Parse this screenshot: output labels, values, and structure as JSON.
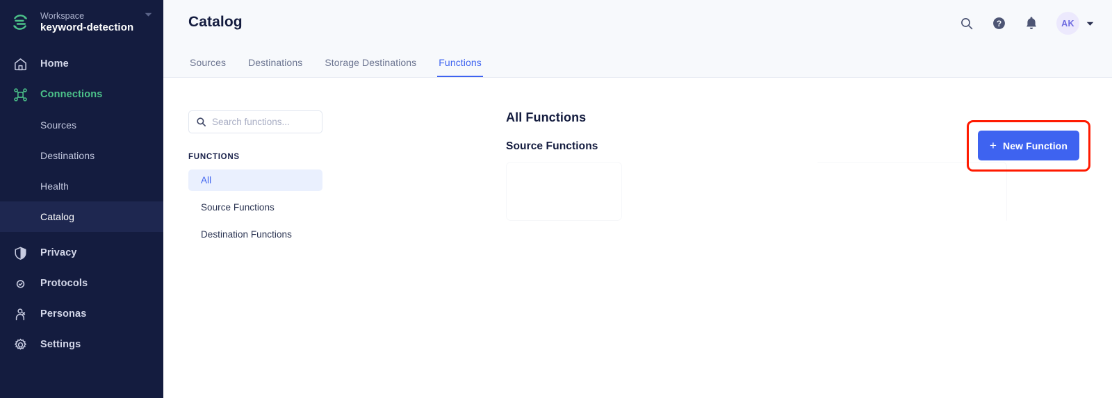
{
  "sidebar": {
    "workspace": {
      "label": "Workspace",
      "name": "keyword-detection",
      "caret_icon": "chevron-down-icon",
      "logo_icon": "segment-logo-icon"
    },
    "items": [
      {
        "label": "Home",
        "icon": "home-icon",
        "accent": false
      },
      {
        "label": "Connections",
        "icon": "connections-nodes-icon",
        "accent": true
      },
      {
        "label": "Privacy",
        "icon": "shield-icon",
        "accent": false
      },
      {
        "label": "Protocols",
        "icon": "protocols-icon",
        "accent": false
      },
      {
        "label": "Personas",
        "icon": "persona-icon",
        "accent": false
      },
      {
        "label": "Settings",
        "icon": "gear-icon",
        "accent": false
      }
    ],
    "sub_items": [
      {
        "label": "Sources",
        "active": false
      },
      {
        "label": "Destinations",
        "active": false
      },
      {
        "label": "Health",
        "active": false
      },
      {
        "label": "Catalog",
        "active": true
      }
    ]
  },
  "header": {
    "title": "Catalog",
    "icons": [
      {
        "name": "search-icon"
      },
      {
        "name": "help-circle-icon"
      },
      {
        "name": "bell-icon"
      }
    ],
    "avatar_initials": "AK",
    "avatar_caret_icon": "chevron-down-icon"
  },
  "tabs": [
    {
      "label": "Sources",
      "active": false
    },
    {
      "label": "Destinations",
      "active": false
    },
    {
      "label": "Storage Destinations",
      "active": false
    },
    {
      "label": "Functions",
      "active": true
    }
  ],
  "left_panel": {
    "search": {
      "placeholder": "Search functions...",
      "value": "",
      "icon": "search-icon"
    },
    "section_label": "FUNCTIONS",
    "items": [
      {
        "label": "All",
        "active": true
      },
      {
        "label": "Source Functions",
        "active": false
      },
      {
        "label": "Destination Functions",
        "active": false
      }
    ]
  },
  "main": {
    "heading": "All Functions",
    "subheading": "Source Functions",
    "new_function_button": {
      "label": "New Function",
      "icon": "plus-icon",
      "highlighted": true
    }
  },
  "colors": {
    "sidebar_bg": "#141c3f",
    "sidebar_active_bg": "#1e2750",
    "accent_green": "#4cc38a",
    "accent_blue": "#3e63f0",
    "highlight_red": "#ff1a00",
    "topbar_bg": "#f7f9fc",
    "avatar_bg": "#ece9fd"
  }
}
